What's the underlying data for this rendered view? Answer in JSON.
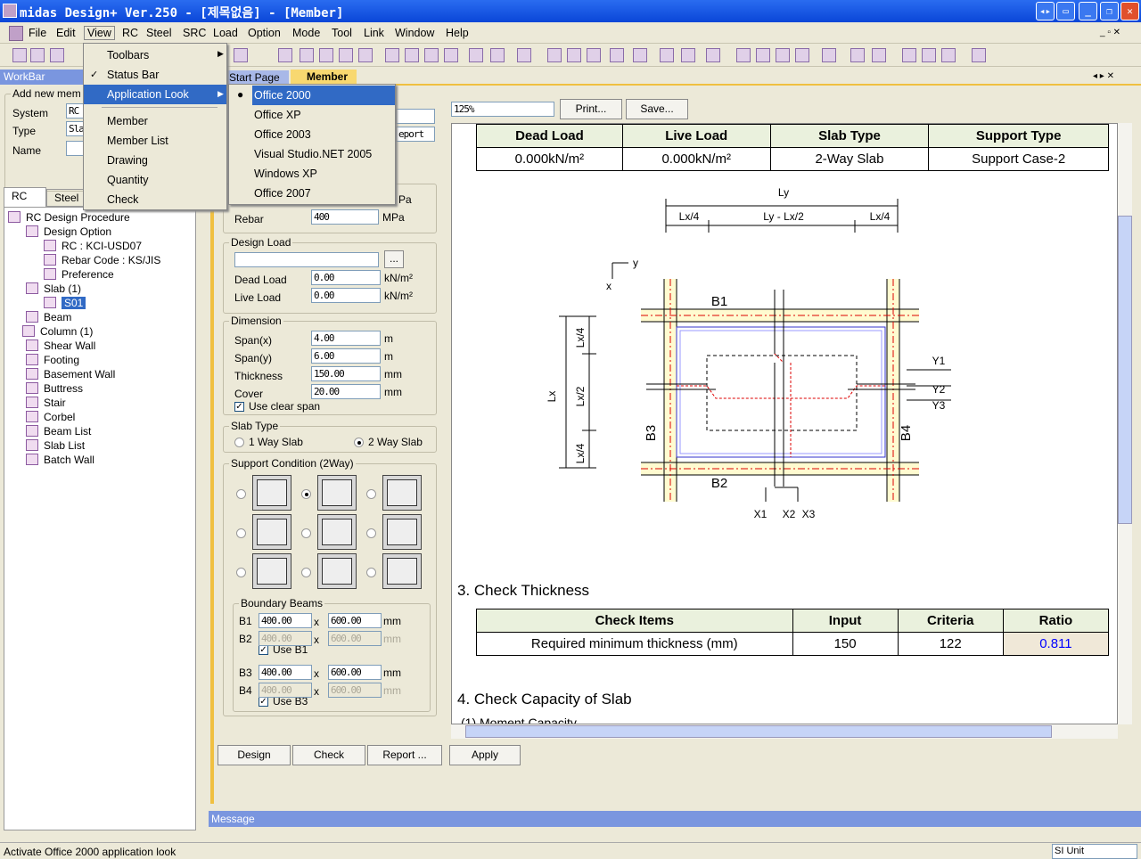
{
  "window": {
    "title": "midas Design+ Ver.250 - [제목없음] - [Member]"
  },
  "menubar": [
    "File",
    "Edit",
    "View",
    "RC",
    "Steel",
    "SRC",
    "Load",
    "Option",
    "Mode",
    "Tool",
    "Link",
    "Window",
    "Help"
  ],
  "view_menu": {
    "items": [
      "Toolbars",
      "Status Bar",
      "Application Look",
      "Member",
      "Member List",
      "Drawing",
      "Quantity",
      "Check"
    ]
  },
  "application_look_menu": {
    "items": [
      "Office 2000",
      "Office XP",
      "Office 2003",
      "Visual Studio.NET 2005",
      "Windows XP",
      "Office 2007"
    ],
    "selected": "Office 2000"
  },
  "workbar": {
    "title": "WorkBar",
    "group": "Add new mem",
    "system_label": "System",
    "system_value": "RC",
    "type_label": "Type",
    "type_value": "Sla",
    "name_label": "Name",
    "tabs": [
      "RC",
      "Steel"
    ],
    "tree": [
      "RC Design Procedure",
      "Design Option",
      "RC : KCI-USD07",
      "Rebar Code : KS/JIS",
      "Preference",
      "Slab (1)",
      "S01",
      "Beam",
      "Column (1)",
      "Shear Wall",
      "Footing",
      "Basement Wall",
      "Buttress",
      "Stair",
      "Corbel",
      "Beam List",
      "Slab List",
      "Batch Wall"
    ]
  },
  "doc_tabs": [
    "Start Page",
    "Member"
  ],
  "form": {
    "report_combo": "eport",
    "unit_partial": "Pa",
    "rebar_label": "Rebar",
    "rebar_value": "400",
    "mpa": "MPa",
    "design_load": {
      "title": "Design Load",
      "dead_label": "Dead Load",
      "dead_value": "0.00",
      "live_label": "Live Load",
      "live_value": "0.00",
      "unit": "kN/m²",
      "more": "..."
    },
    "dimension": {
      "title": "Dimension",
      "rows": [
        {
          "label": "Span(x)",
          "value": "4.00",
          "unit": "m"
        },
        {
          "label": "Span(y)",
          "value": "6.00",
          "unit": "m"
        },
        {
          "label": "Thickness",
          "value": "150.00",
          "unit": "mm"
        },
        {
          "label": "Cover",
          "value": "20.00",
          "unit": "mm"
        }
      ],
      "clear_span": "Use clear span",
      "clear_span_checked": true
    },
    "slab_type": {
      "title": "Slab Type",
      "one_way": "1 Way Slab",
      "two_way": "2 Way Slab",
      "selected": "2 Way Slab"
    },
    "support": {
      "title": "Support Condition (2Way)",
      "selected_index": 1
    },
    "boundary": {
      "title": "Boundary Beams",
      "x": "x",
      "unit": "mm",
      "rows": [
        {
          "label": "B1",
          "b": "400.00",
          "h": "600.00",
          "enabled": true
        },
        {
          "label": "B2",
          "b": "400.00",
          "h": "600.00",
          "enabled": false
        },
        {
          "label": "B3",
          "b": "400.00",
          "h": "600.00",
          "enabled": true
        },
        {
          "label": "B4",
          "b": "400.00",
          "h": "600.00",
          "enabled": false
        }
      ],
      "use_b1": "Use B1",
      "use_b3": "Use B3"
    },
    "buttons": {
      "design": "Design",
      "check": "Check",
      "report": "Report ...",
      "apply": "Apply"
    }
  },
  "report": {
    "zoom": "125%",
    "print": "Print...",
    "save": "Save...",
    "load_table": {
      "headers": [
        "Dead Load",
        "Live Load",
        "Slab Type",
        "Support Type"
      ],
      "row": [
        "0.000kN/m²",
        "0.000kN/m²",
        "2-Way Slab",
        "Support Case-2"
      ]
    },
    "diagram": {
      "Ly": "Ly",
      "Lx4a": "Lx/4",
      "LyLx2": "Ly - Lx/2",
      "Lx4b": "Lx/4",
      "y": "y",
      "x": "x",
      "B1": "B1",
      "B2": "B2",
      "B3": "B3",
      "B4": "B4",
      "Lx": "Lx",
      "vLx4a": "Lx/4",
      "vLx2": "Lx/2",
      "vLx4b": "Lx/4",
      "Y1": "Y1",
      "Y2": "Y2",
      "Y3": "Y3",
      "X1": "X1",
      "X2": "X2",
      "X3": "X3"
    },
    "section3": "3. Check Thickness",
    "thick_table": {
      "headers": [
        "Check Items",
        "Input",
        "Criteria",
        "Ratio"
      ],
      "row": [
        "Required minimum thickness (mm)",
        "150",
        "122",
        "0.811"
      ]
    },
    "section4": "4. Check Capacity of Slab",
    "section4_1": "(1) Moment Capacity"
  },
  "message": {
    "title": "Message"
  },
  "status": {
    "text": "Activate Office 2000 application look",
    "unit": "SI Unit"
  },
  "colors": {
    "titlebar": "#0a46d8",
    "menu_highlight": "#316ac5",
    "ratio": "#0000ff",
    "header_fill": "#eaf1dd"
  }
}
